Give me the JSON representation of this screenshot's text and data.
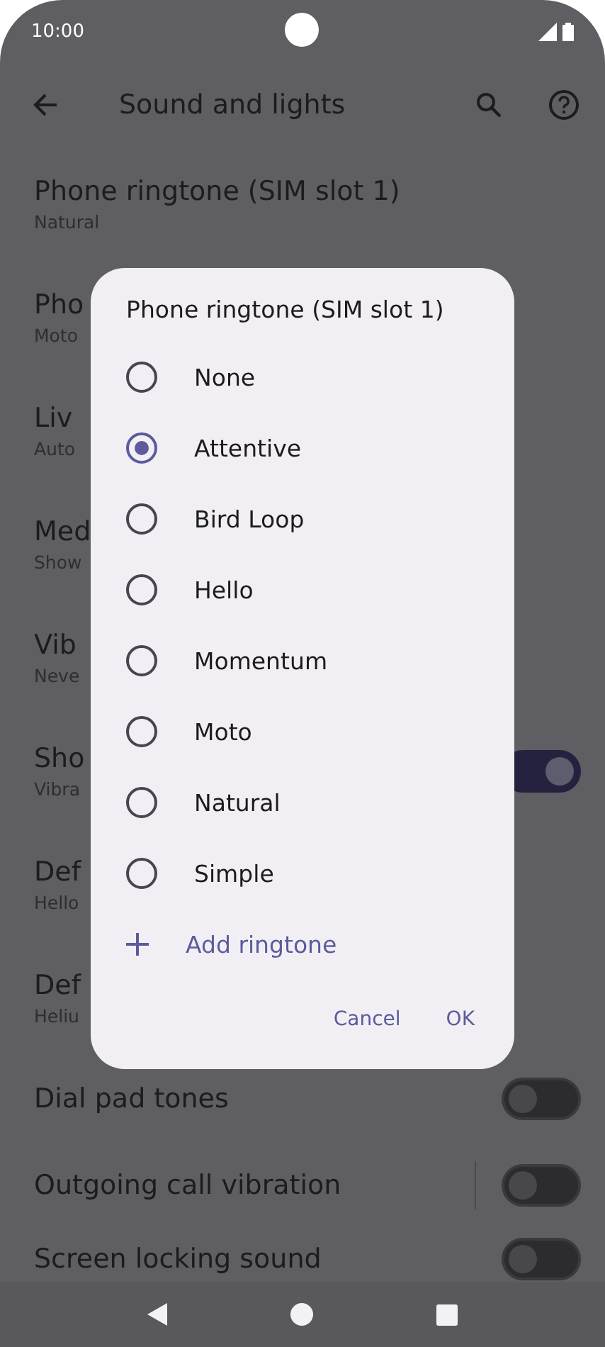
{
  "status_bar": {
    "time": "10:00"
  },
  "top_bar": {
    "title": "Sound and lights"
  },
  "settings": [
    {
      "kind": "text",
      "title": "Phone ringtone (SIM slot 1)",
      "subtitle": "Natural"
    },
    {
      "kind": "text",
      "title": "Pho",
      "subtitle": "Moto"
    },
    {
      "kind": "text",
      "title": "Liv",
      "subtitle": "Auto"
    },
    {
      "kind": "text",
      "title": "Med",
      "subtitle": "Show"
    },
    {
      "kind": "text",
      "title": "Vib",
      "subtitle": "Neve"
    },
    {
      "kind": "text",
      "title": "Sho",
      "subtitle": "Vibra"
    },
    {
      "kind": "text",
      "title": "Def",
      "subtitle": "Hello"
    },
    {
      "kind": "text",
      "title": "Def",
      "subtitle": "Heliu"
    },
    {
      "kind": "switch",
      "title": "Dial pad tones",
      "on": false,
      "divider": false
    },
    {
      "kind": "switch",
      "title": "Outgoing call vibration",
      "on": false,
      "divider": true
    },
    {
      "kind": "switch",
      "title": "Screen locking sound",
      "on": false,
      "divider": false
    }
  ],
  "short_switch": {
    "on": true
  },
  "dialog": {
    "title": "Phone ringtone (SIM slot 1)",
    "options": [
      {
        "label": "None",
        "selected": false
      },
      {
        "label": "Attentive",
        "selected": true
      },
      {
        "label": "Bird Loop",
        "selected": false
      },
      {
        "label": "Hello",
        "selected": false
      },
      {
        "label": "Momentum",
        "selected": false
      },
      {
        "label": "Moto",
        "selected": false
      },
      {
        "label": "Natural",
        "selected": false
      },
      {
        "label": "Simple",
        "selected": false
      }
    ],
    "add_label": "Add ringtone",
    "buttons": [
      "Cancel",
      "OK"
    ]
  }
}
